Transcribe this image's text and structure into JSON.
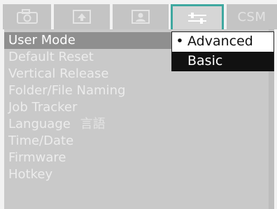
{
  "tabs": [
    {
      "name": "camera-tab",
      "icon": "camera-icon",
      "active": false
    },
    {
      "name": "playback-tab",
      "icon": "playback-icon",
      "active": false
    },
    {
      "name": "custom-tab",
      "icon": "person-icon",
      "active": false
    },
    {
      "name": "setup-tab",
      "icon": "settings-sliders-icon",
      "active": true
    },
    {
      "name": "csm-tab",
      "label": "CSM",
      "active": false
    }
  ],
  "menu": {
    "items": [
      "User Mode",
      "Default Reset",
      "Vertical Release",
      "Folder/File Naming",
      "Job Tracker",
      "Language",
      "Time/Date",
      "Firmware",
      "Hotkey"
    ],
    "language_glyphs": "言語",
    "selected_index": 0
  },
  "popup": {
    "options": [
      "Advanced",
      "Basic"
    ],
    "checked": "Advanced",
    "highlighted": "Basic",
    "bullet": "•"
  },
  "colors": {
    "accent": "#3fa8a0",
    "panel": "#c9c9c9",
    "selected_row": "#8f8f8f",
    "popup_highlight": "#111111"
  }
}
